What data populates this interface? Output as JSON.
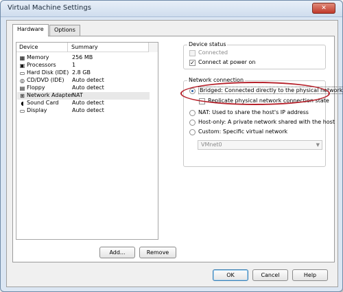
{
  "window": {
    "title": "Virtual Machine Settings",
    "close_glyph": "✕"
  },
  "tabs": [
    {
      "label": "Hardware",
      "active": true
    },
    {
      "label": "Options",
      "active": false
    }
  ],
  "device_list": {
    "columns": {
      "device": "Device",
      "summary": "Summary"
    },
    "rows": [
      {
        "device": "Memory",
        "summary": "256 MB",
        "icon": "memory-icon",
        "glyph": "▦"
      },
      {
        "device": "Processors",
        "summary": "1",
        "icon": "processor-icon",
        "glyph": "▣"
      },
      {
        "device": "Hard Disk (IDE)",
        "summary": "2.8 GB",
        "icon": "hard-disk-icon",
        "glyph": "▭"
      },
      {
        "device": "CD/DVD (IDE)",
        "summary": "Auto detect",
        "icon": "cd-dvd-icon",
        "glyph": "◎"
      },
      {
        "device": "Floppy",
        "summary": "Auto detect",
        "icon": "floppy-icon",
        "glyph": "▤"
      },
      {
        "device": "Network Adapter",
        "summary": "NAT",
        "icon": "network-adapter-icon",
        "glyph": "⊞",
        "selected": true
      },
      {
        "device": "Sound Card",
        "summary": "Auto detect",
        "icon": "sound-card-icon",
        "glyph": "◖"
      },
      {
        "device": "Display",
        "summary": "Auto detect",
        "icon": "display-icon",
        "glyph": "▭"
      }
    ]
  },
  "list_buttons": {
    "add": "Add...",
    "remove": "Remove"
  },
  "device_status": {
    "legend": "Device status",
    "connected": {
      "label": "Connected",
      "checked": false,
      "disabled": true
    },
    "connect_at_power_on": {
      "label": "Connect at power on",
      "checked": true
    }
  },
  "network_connection": {
    "legend": "Network connection",
    "bridged": {
      "label": "Bridged: Connected directly to the physical network",
      "selected": true
    },
    "replicate": {
      "label": "Replicate physical network connection state",
      "checked": false
    },
    "nat": {
      "label": "NAT: Used to share the host's IP address",
      "selected": false
    },
    "host_only": {
      "label": "Host-only: A private network shared with the host",
      "selected": false
    },
    "custom": {
      "label": "Custom: Specific virtual network",
      "selected": false
    },
    "vmnet_value": "VMnet0"
  },
  "footer_buttons": {
    "ok": "OK",
    "cancel": "Cancel",
    "help": "Help"
  },
  "colors": {
    "highlight": "#b6202a",
    "accent": "#1d5aa6"
  }
}
